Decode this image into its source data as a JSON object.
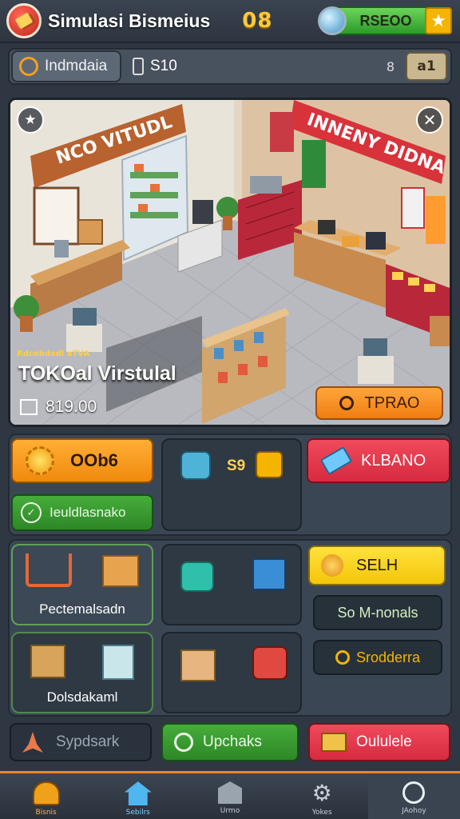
{
  "header": {
    "title": "Simulasi Bismeius",
    "counter": "08",
    "currency_value": "RSEOO"
  },
  "subbar": {
    "location": "Indmdaia",
    "money": "S10",
    "sep": "8",
    "button": "a1"
  },
  "scene": {
    "store_sign": "NCO VITUDL",
    "store_sign_right": "INNENY DIDNA",
    "small_label": "Rdcebdadl aTVA",
    "store_name": "TOKOal Virstulal",
    "price": "819.00",
    "action_button": "TPRAO"
  },
  "row1": {
    "btn_orange": "OOb6",
    "btn_green": "Ieuldlasnako",
    "mid_value": "S9",
    "btn_red": "KLBANO"
  },
  "row2": {
    "cell1_label": "Pectemalsadn",
    "btn_yellow": "SELH",
    "btn_dark1": "So M-nonals"
  },
  "row3": {
    "cell1_label": "Dolsdakaml",
    "btn_dark2": "Srodderra"
  },
  "actions": {
    "left": "Sypdsark",
    "middle": "Upchaks",
    "right": "Oululele"
  },
  "bottomnav": [
    {
      "label": "Bisnis"
    },
    {
      "label": "Sebilrs"
    },
    {
      "label": "Urmo"
    },
    {
      "label": "Yokes"
    },
    {
      "label": "JAohoy"
    }
  ],
  "colors": {
    "accent_orange": "#f08a0e",
    "accent_green": "#2e8727",
    "accent_red": "#d72a40",
    "accent_yellow": "#f3c60a",
    "panel": "#3b4654"
  }
}
